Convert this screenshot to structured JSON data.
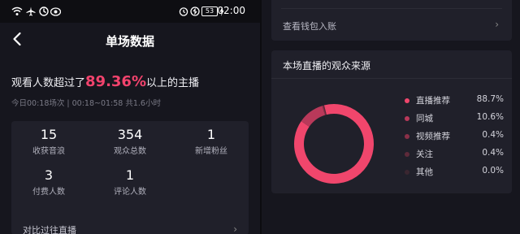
{
  "status_bar": {
    "time": "02:00",
    "battery": "53"
  },
  "nav": {
    "title": "单场数据"
  },
  "summary": {
    "prefix": "观看人数超过了",
    "percent": "89.36%",
    "suffix": "以上的主播",
    "session": "今日00:18场次 | 00:18~01:58 共1.6小时"
  },
  "stats": [
    {
      "value": "15",
      "label": "收获音浪"
    },
    {
      "value": "354",
      "label": "观众总数"
    },
    {
      "value": "1",
      "label": "新增粉丝"
    },
    {
      "value": "3",
      "label": "付费人数"
    },
    {
      "value": "1",
      "label": "评论人数"
    }
  ],
  "compare_label": "对比过往直播",
  "wallet_label": "查看钱包入账",
  "source_card": {
    "title": "本场直播的观众来源",
    "colors": [
      "#f0466c",
      "#b9395a",
      "#8a3048",
      "#5e2a3a",
      "#3a2630"
    ],
    "legend": [
      {
        "name": "直播推荐",
        "value": "88.7%"
      },
      {
        "name": "同城",
        "value": "10.6%"
      },
      {
        "name": "视频推荐",
        "value": "0.4%"
      },
      {
        "name": "关注",
        "value": "0.4%"
      },
      {
        "name": "其他",
        "value": "0.0%"
      }
    ],
    "shares": [
      88.7,
      10.6,
      0.4,
      0.4,
      0.0
    ]
  },
  "colors": {
    "accent": "#f2436d",
    "card": "#20202a",
    "background": "#16161e"
  }
}
